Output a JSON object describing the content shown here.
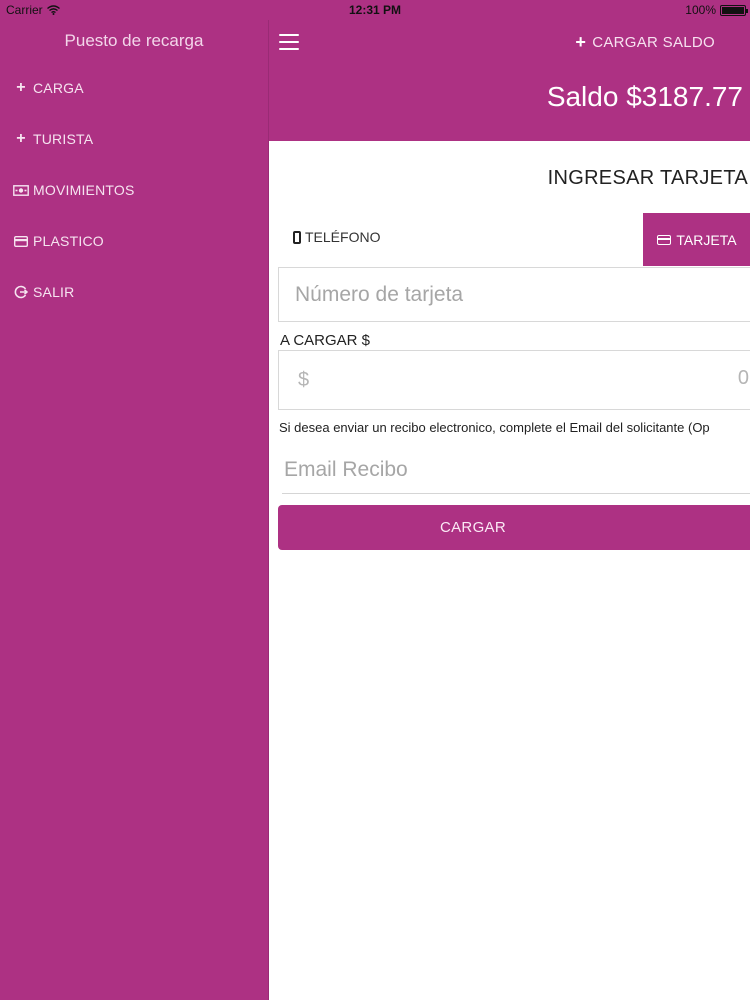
{
  "status_bar": {
    "carrier": "Carrier",
    "time": "12:31 PM",
    "battery": "100%",
    "battery_level": 1.0
  },
  "sidebar": {
    "title": "Puesto de recarga",
    "items": [
      {
        "label": "CARGA",
        "icon": "plus-icon"
      },
      {
        "label": "TURISTA",
        "icon": "plus-icon"
      },
      {
        "label": "MOVIMIENTOS",
        "icon": "money-icon"
      },
      {
        "label": "PLASTICO",
        "icon": "credit-card-icon"
      },
      {
        "label": "SALIR",
        "icon": "logout-icon"
      }
    ]
  },
  "header": {
    "menu_icon": "hamburger-icon",
    "cargar_saldo_label": "CARGAR SALDO",
    "saldo": "Saldo $3187.77"
  },
  "form": {
    "title": "INGRESAR TARJETA",
    "tabs": [
      {
        "label": "TELÉFONO",
        "icon": "phone-icon",
        "active": false
      },
      {
        "label": "TARJETA",
        "icon": "credit-card-icon",
        "active": true
      }
    ],
    "card_number_placeholder": "Número de tarjeta",
    "amount_label": "A CARGAR $",
    "amount_prefix": "$",
    "amount_value": "0",
    "receipt_hint": "Si desea enviar un recibo electronico, complete el Email del solicitante (Op",
    "email_placeholder": "Email Recibo",
    "submit_label": "CARGAR"
  },
  "colors": {
    "brand": "#ad3183",
    "background": "#ffffff"
  }
}
